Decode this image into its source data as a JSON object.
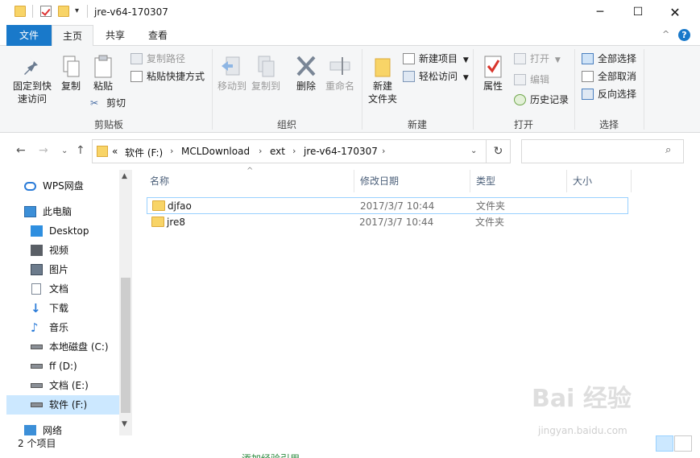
{
  "window": {
    "title": "jre-v64-170307",
    "minimize_icon": "minimize-icon",
    "maximize_icon": "maximize-icon",
    "close_icon": "close-icon"
  },
  "ribbon_tabs": [
    "文件",
    "主页",
    "共享",
    "查看"
  ],
  "ribbon": {
    "clipboard": {
      "pin": "固定到快\n速访问",
      "copy": "复制",
      "paste": "粘贴",
      "copy_path": "复制路径",
      "paste_shortcut": "粘贴快捷方式",
      "cut": "剪切",
      "group": "剪贴板"
    },
    "organize": {
      "move_to": "移动到",
      "copy_to": "复制到",
      "delete": "删除",
      "rename": "重命名",
      "group": "组织"
    },
    "new": {
      "new_folder": "新建\n文件夹",
      "new_item": "新建项目",
      "easy_access": "轻松访问",
      "group": "新建"
    },
    "open": {
      "properties": "属性",
      "open": "打开",
      "edit": "编辑",
      "history": "历史记录",
      "group": "打开"
    },
    "select": {
      "select_all": "全部选择",
      "select_none": "全部取消",
      "invert": "反向选择",
      "group": "选择"
    }
  },
  "address": {
    "overflow": "«",
    "crumbs": [
      "软件 (F:)",
      "MCLDownload",
      "ext",
      "jre-v64-170307"
    ]
  },
  "nav_pane": {
    "items": [
      {
        "label": "WPS网盘",
        "icon": "cloud-icon"
      },
      {
        "label": "此电脑",
        "icon": "computer-icon"
      },
      {
        "label": "Desktop",
        "icon": "desktop-icon"
      },
      {
        "label": "视频",
        "icon": "video-icon"
      },
      {
        "label": "图片",
        "icon": "picture-icon"
      },
      {
        "label": "文档",
        "icon": "document-icon"
      },
      {
        "label": "下载",
        "icon": "download-icon"
      },
      {
        "label": "音乐",
        "icon": "music-icon"
      },
      {
        "label": "本地磁盘 (C:)",
        "icon": "drive-icon"
      },
      {
        "label": "ff (D:)",
        "icon": "drive-icon"
      },
      {
        "label": "文档 (E:)",
        "icon": "drive-icon"
      },
      {
        "label": "软件 (F:)",
        "icon": "drive-icon"
      },
      {
        "label": "网络",
        "icon": "network-icon"
      }
    ]
  },
  "file_list": {
    "columns": [
      "名称",
      "修改日期",
      "类型",
      "大小"
    ],
    "rows": [
      {
        "name": "djfao",
        "date": "2017/3/7 10:44",
        "type": "文件夹",
        "size": ""
      },
      {
        "name": "jre8",
        "date": "2017/3/7 10:44",
        "type": "文件夹",
        "size": ""
      }
    ]
  },
  "status": {
    "count": "2 个项目"
  },
  "watermark": {
    "brand": "Bai 经验",
    "url": "jingyan.baidu.com"
  },
  "partial_text": "添加经验引用"
}
